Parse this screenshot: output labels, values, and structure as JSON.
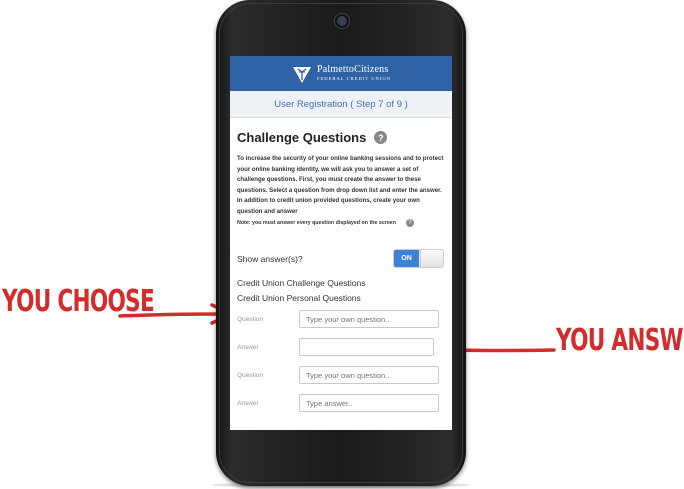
{
  "annotations": {
    "left": "YOU CHOOSE",
    "right": "YOU ANSWER",
    "color": "#d42b2b"
  },
  "brand": {
    "name": "PalmettoCitizens",
    "subtitle": "FEDERAL CREDIT UNION",
    "color": "#2f63a6",
    "logo_icon": "palmetto-tree-logo"
  },
  "step": "User Registration ( Step 7 of 9 )",
  "page": {
    "title": "Challenge Questions",
    "help_icon": "?",
    "intro": "To increase the security of your online banking sessions and to protect your online banking identity, we will ask you to answer a set of challenge questions. First, you must create the answer to these questions. Select a question from drop down list and enter the answer. In addition to credit union provided questions, create your own question and answer",
    "note": "Note: you must answer every question displayed on the screen",
    "show_answers_label": "Show answer(s)?",
    "toggle_label": "ON",
    "section_cu": "Credit Union Challenge Questions",
    "section_personal": "Credit Union Personal Questions",
    "form": [
      {
        "label": "Question",
        "value": "",
        "placeholder": "Type your own question.."
      },
      {
        "label": "Answer",
        "value": "",
        "placeholder": ""
      },
      {
        "label": "Question",
        "value": "",
        "placeholder": "Type your own question.."
      },
      {
        "label": "Answer",
        "value": "",
        "placeholder": "Type answer.."
      }
    ]
  }
}
